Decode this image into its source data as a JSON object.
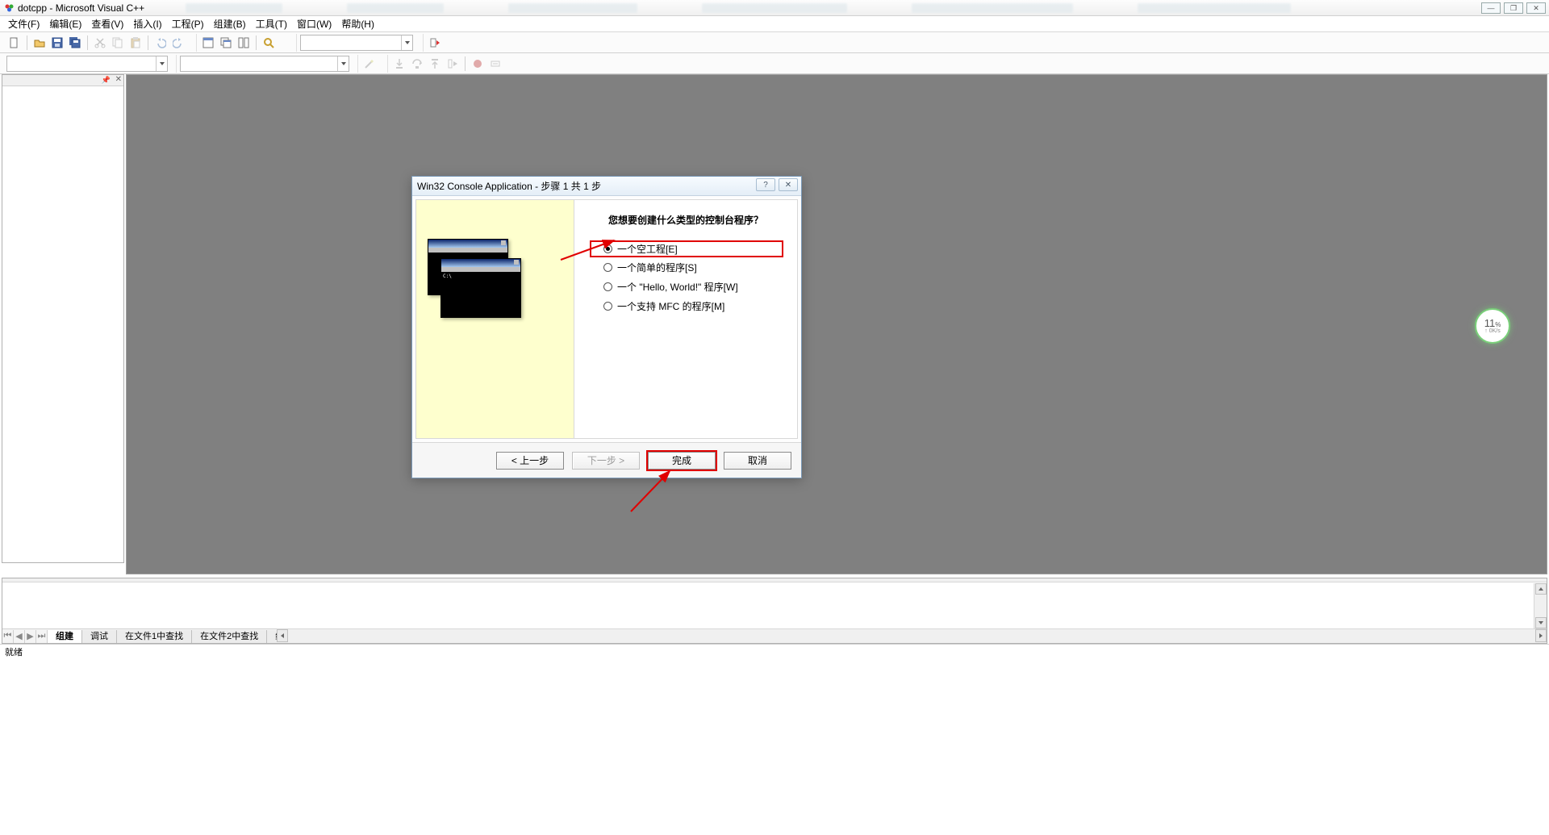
{
  "window": {
    "title": "dotcpp - Microsoft Visual C++"
  },
  "menu": {
    "items": [
      "文件(F)",
      "编辑(E)",
      "查看(V)",
      "插入(I)",
      "工程(P)",
      "组建(B)",
      "工具(T)",
      "窗口(W)",
      "帮助(H)"
    ]
  },
  "toolbar1": {
    "icons": [
      "new-file",
      "open-file",
      "save",
      "save-all",
      "cut",
      "copy",
      "paste",
      "undo",
      "redo",
      "workspace",
      "window-list",
      "tile",
      "find"
    ]
  },
  "toolbar2": {
    "combo1": "",
    "combo2": "",
    "combo3": "",
    "icons": [
      "step-into",
      "step-over",
      "step-out",
      "run-to",
      "breakpoint",
      "watch"
    ]
  },
  "dialog": {
    "title": "Win32 Console Application - 步骤 1 共 1 步",
    "question": "您想要创建什么类型的控制台程序？",
    "options": [
      {
        "label": "一个空工程[E]",
        "checked": true,
        "highlighted": true
      },
      {
        "label": "一个简单的程序[S]",
        "checked": false,
        "highlighted": false
      },
      {
        "label": "一个 \"Hello, World!\" 程序[W]",
        "checked": false,
        "highlighted": false
      },
      {
        "label": "一个支持 MFC 的程序[M]",
        "checked": false,
        "highlighted": false
      }
    ],
    "buttons": {
      "back": "< 上一步",
      "next": "下一步 >",
      "finish": "完成",
      "cancel": "取消"
    },
    "help_icon": "?",
    "close_icon": "✕"
  },
  "output_tabs": {
    "tabs": [
      "组建",
      "调试",
      "在文件1中查找",
      "在文件2中查找",
      "结果"
    ],
    "active_index": 0
  },
  "status_bar": {
    "text": "就绪"
  },
  "float_badge": {
    "value": "11",
    "unit": "%",
    "sub": "↑ 0K/s"
  },
  "win_controls": {
    "minimize": "—",
    "maximize": "❐",
    "close": "✕"
  }
}
